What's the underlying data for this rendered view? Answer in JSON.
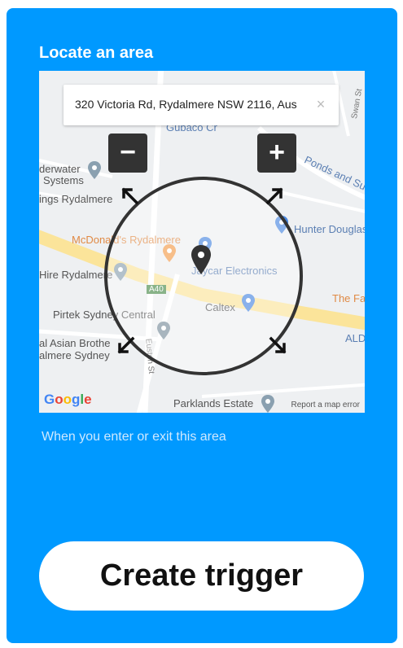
{
  "section": {
    "title": "Locate an area"
  },
  "search": {
    "value": "320 Victoria Rd, Rydalmere NSW 2116, Aus",
    "clear_icon": "×"
  },
  "zoom": {
    "out_label": "−",
    "in_label": "+"
  },
  "map_labels": {
    "underwater": "derwater",
    "systems": "Systems",
    "rydalmere_left": "ings Rydalmere",
    "mcdonalds": "McDonald's Rydalmere",
    "hunter_douglas": "Hunter Douglas",
    "jaycar": "Jaycar Electronics",
    "hire": "Hire Rydalmere",
    "a40": "A40",
    "caltex": "Caltex",
    "pirtek": "Pirtek Sydney Central",
    "the_fa": "The Fa",
    "asian": "al Asian Brothe",
    "almere": "almere Sydney",
    "ald": "ALD",
    "ponds": "Ponds and Su",
    "gubaco": "Gubaco Cr",
    "swan": "Swan St",
    "parklands": "Parklands Estate",
    "euston": "Euston St"
  },
  "map_footer": {
    "google": "Google",
    "report": "Report a map error"
  },
  "helper_text": "When you enter or exit this area",
  "cta": {
    "label": "Create trigger"
  },
  "colors": {
    "brand": "#0099ff",
    "button_dark": "#333333",
    "text_blue": "#5b7fb3",
    "text_gray": "#555555",
    "text_orange": "#e08a45"
  }
}
